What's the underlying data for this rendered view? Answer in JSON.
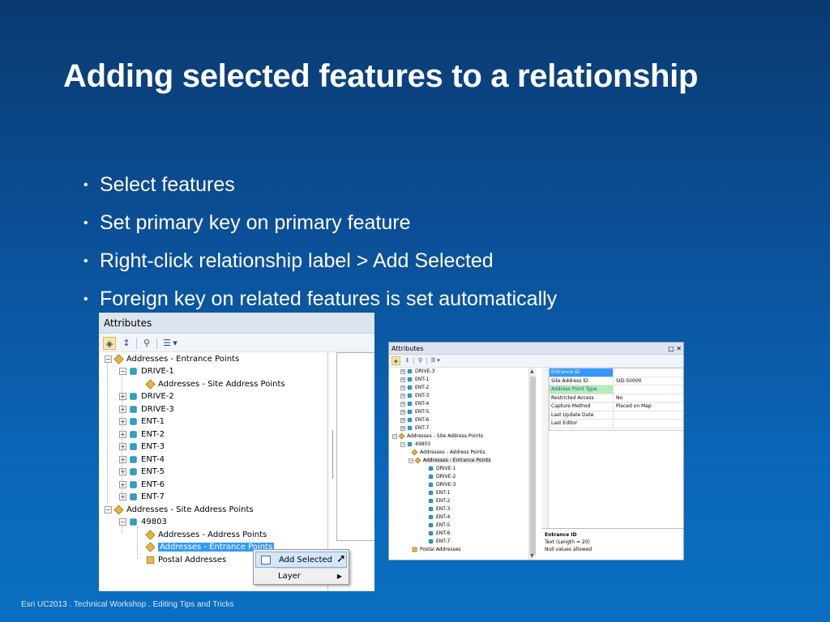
{
  "slide": {
    "title": "Adding selected features to a relationship",
    "bullets": [
      "Select features",
      "Set primary key on primary feature",
      "Right-click relationship label > Add Selected",
      "Foreign key on related features is set automatically"
    ],
    "footer": "Esri UC2013 . Technical Workshop . Editing Tips and Tricks"
  },
  "left_window": {
    "title": "Attributes",
    "tree": [
      "Addresses - Entrance Points",
      "DRIVE-1",
      "Addresses - Site Address Points",
      "DRIVE-2",
      "DRIVE-3",
      "ENT-1",
      "ENT-2",
      "ENT-3",
      "ENT-4",
      "ENT-5",
      "ENT-6",
      "ENT-7",
      "Addresses - Site Address Points",
      "49803",
      "Addresses - Address Points",
      "Addresses - Entrance Points",
      "Postal Addresses"
    ],
    "selected_index": 15,
    "context_menu": {
      "items": [
        "Add Selected",
        "Layer"
      ],
      "hovered": "Add Selected"
    }
  },
  "right_window": {
    "title": "Attributes",
    "tree": [
      "DRIVE-3",
      "ENT-1",
      "ENT-2",
      "ENT-3",
      "ENT-4",
      "ENT-5",
      "ENT-6",
      "ENT-7",
      "Addresses - Site Address Points",
      "49803",
      "Addresses - Address Points",
      "Addresses - Entrance Points",
      "DRIVE-1",
      "DRIVE-2",
      "DRIVE-3",
      "ENT-1",
      "ENT-2",
      "ENT-3",
      "ENT-4",
      "ENT-5",
      "ENT-6",
      "ENT-7",
      "Postal Addresses"
    ],
    "attributes": [
      {
        "field": "Entrance ID",
        "value": ""
      },
      {
        "field": "Site Address ID",
        "value": "SID-50000"
      },
      {
        "field": "Address Point Type",
        "value": ""
      },
      {
        "field": "Restricted Access",
        "value": "No"
      },
      {
        "field": "Capture Method",
        "value": "Placed on Map"
      },
      {
        "field": "Last Update Date",
        "value": ""
      },
      {
        "field": "Last Editor",
        "value": ""
      }
    ],
    "info": {
      "title": "Entrance ID",
      "line1": "Text (Length = 20)",
      "line2": "Null values allowed"
    }
  },
  "colors": {
    "selection": "#3399ff",
    "primary_key_highlight": "#b9ebb4",
    "background_top": "#093a70",
    "background_bottom": "#0a6fc2"
  },
  "icons": {
    "relationship": "relationship-diamond-icon",
    "feature": "feature-icon",
    "table": "table-icon"
  }
}
